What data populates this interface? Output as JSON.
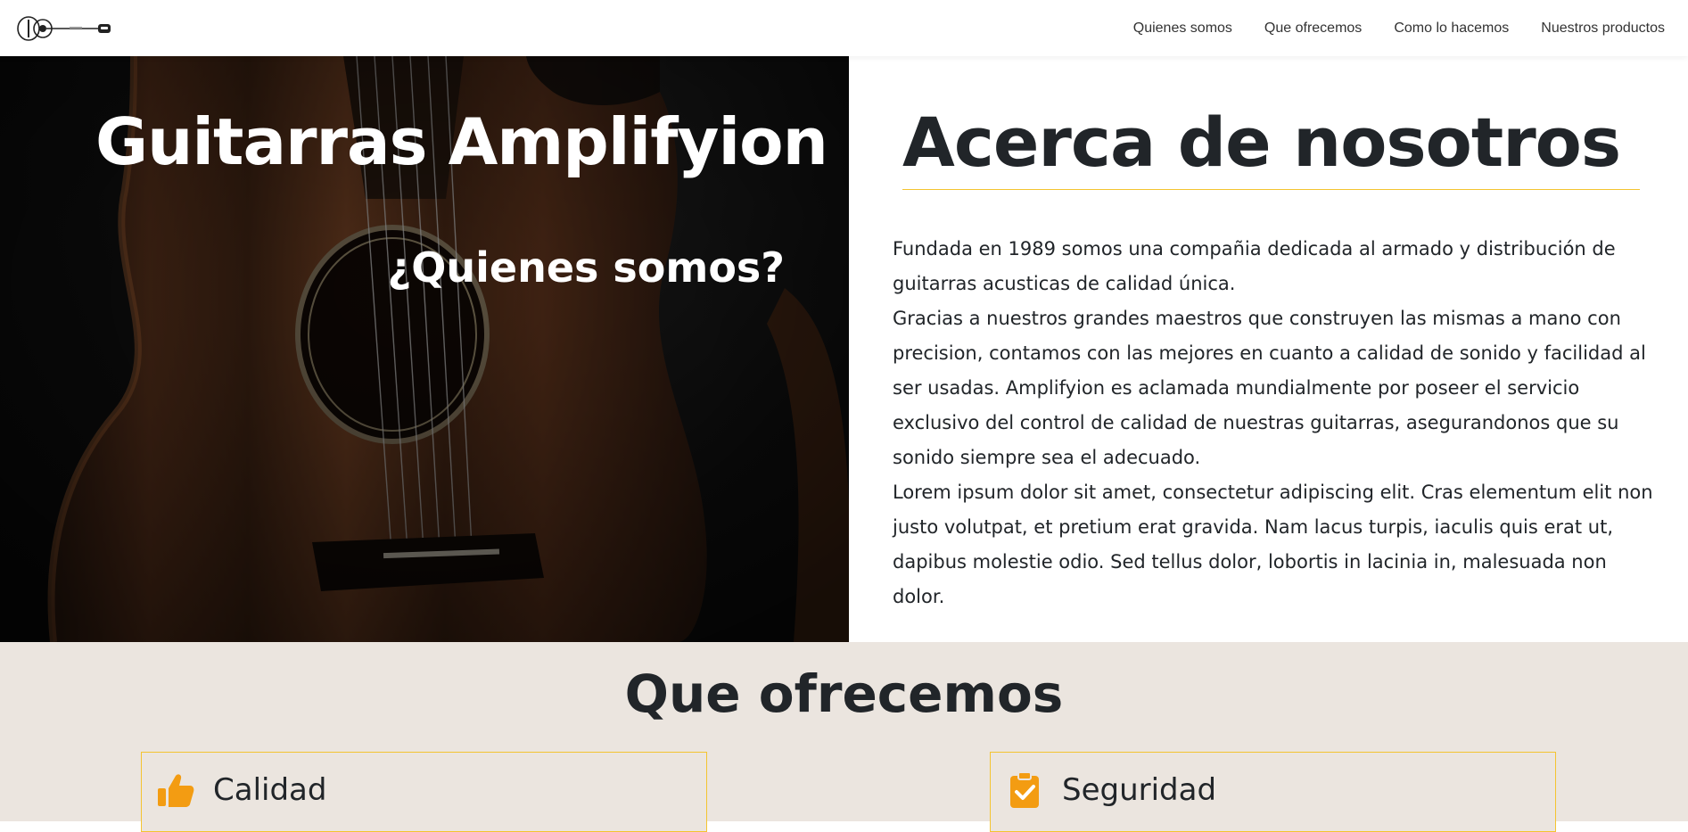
{
  "nav": {
    "links": [
      "Quienes somos",
      "Que ofrecemos",
      "Como lo hacemos",
      "Nuestros productos"
    ]
  },
  "hero": {
    "title": "Guitarras Amplifyion",
    "subtitle": "¿Quienes somos?"
  },
  "about": {
    "title": "Acerca de nosotros",
    "paragraphs": [
      "Fundada en 1989 somos una compañia dedicada al armado y distribución de guitarras acusticas de calidad única.",
      "Gracias a nuestros grandes maestros que construyen las mismas a mano con precision, contamos con las mejores en cuanto a calidad de sonido y facilidad al ser usadas. Amplifyion es aclamada mundialmente por poseer el servicio exclusivo del control de calidad de nuestras guitarras, asegurandonos que su sonido siempre sea el adecuado.",
      "Lorem ipsum dolor sit amet, consectetur adipiscing elit. Cras elementum elit non justo volutpat, et pretium erat gravida. Nam lacus turpis, iaculis quis erat ut, dapibus molestie odio. Sed tellus dolor, lobortis in lacinia in, malesuada non dolor."
    ]
  },
  "offer": {
    "title": "Que ofrecemos",
    "cards": [
      {
        "label": "Calidad",
        "icon": "thumbs-up-icon"
      },
      {
        "label": "Seguridad",
        "icon": "clipboard-check-icon"
      }
    ]
  },
  "colors": {
    "accent": "#f4c430",
    "icon": "#f39c12",
    "section_bg": "#ebe5df"
  }
}
